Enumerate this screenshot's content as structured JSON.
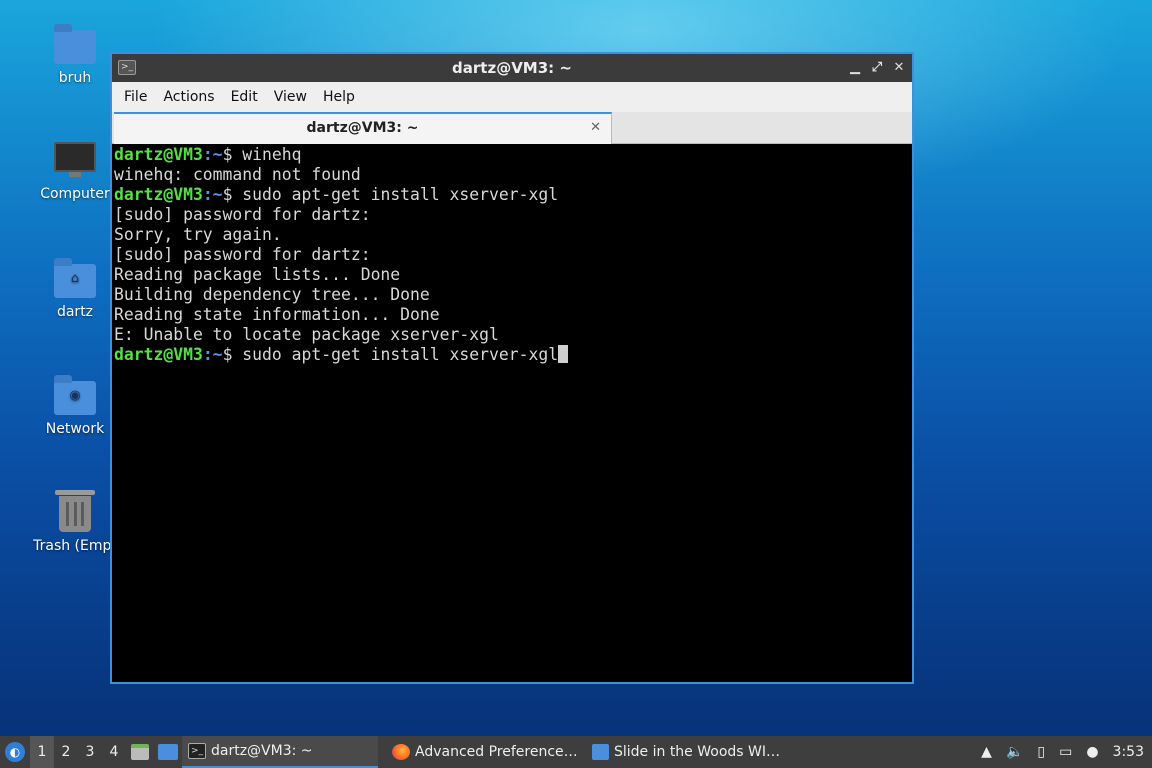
{
  "desktop": {
    "icons": [
      {
        "label": "bruh",
        "icon": "folder-icon"
      },
      {
        "label": "Computer",
        "icon": "computer-icon"
      },
      {
        "label": "dartz",
        "icon": "home-folder-icon"
      },
      {
        "label": "Network",
        "icon": "network-icon"
      },
      {
        "label": "Trash (Empt",
        "icon": "trash-icon"
      }
    ]
  },
  "window": {
    "title": "dartz@VM3: ~",
    "app_icon": ">_",
    "controls": {
      "minimize": "▁",
      "maximize": "⤢",
      "close": "✕"
    },
    "menu": [
      "File",
      "Actions",
      "Edit",
      "View",
      "Help"
    ],
    "tab": {
      "label": "dartz@VM3: ~",
      "close": "✕"
    },
    "terminal_lines": [
      {
        "user": "dartz@VM3",
        "path": ":~",
        "cmd": "$ winehq"
      },
      {
        "text": "winehq: command not found"
      },
      {
        "user": "dartz@VM3",
        "path": ":~",
        "cmd": "$ sudo apt-get install xserver-xgl"
      },
      {
        "text": "[sudo] password for dartz:"
      },
      {
        "text": "Sorry, try again."
      },
      {
        "text": "[sudo] password for dartz:"
      },
      {
        "text": "Reading package lists... Done"
      },
      {
        "text": "Building dependency tree... Done"
      },
      {
        "text": "Reading state information... Done"
      },
      {
        "text": "E: Unable to locate package xserver-xgl"
      },
      {
        "user": "dartz@VM3",
        "path": ":~",
        "cmd": "$ sudo apt-get install xserver-xgl",
        "cursor": true
      }
    ]
  },
  "taskbar": {
    "workspaces": [
      "1",
      "2",
      "3",
      "4"
    ],
    "active_workspace": "1",
    "tasks": [
      {
        "label": "dartz@VM3: ~",
        "icon": "terminal-icon",
        "active": true
      },
      {
        "label": "Advanced Preference…",
        "icon": "firefox-icon",
        "active": false
      },
      {
        "label": "Slide in the Woods WI…",
        "icon": "folder-icon",
        "active": false
      }
    ],
    "clock": "3:53"
  },
  "colors": {
    "accent": "#3d8fe0",
    "prompt_user": "#55e045",
    "prompt_path": "#5b8fe8"
  }
}
